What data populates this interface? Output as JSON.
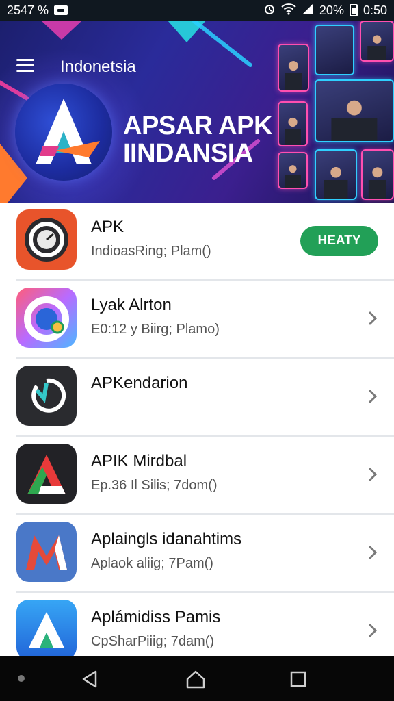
{
  "status_bar": {
    "left_text": "2547 %",
    "left_icons": [
      "message-icon"
    ],
    "right_icons": [
      "alarm-icon",
      "wifi-icon",
      "signal-icon"
    ],
    "battery_text": "20%",
    "time": "0:50"
  },
  "header": {
    "menu_icon": "hamburger-menu-icon",
    "title": "Indonetsia"
  },
  "banner": {
    "logo_letter": "A",
    "headline_line1": "APSAR APK",
    "headline_line2": "IINDANSIA"
  },
  "apps": [
    {
      "name": "APK",
      "subtitle": "IndioasRing; Plam()",
      "icon": "clock-dial-icon",
      "action": "button",
      "action_label": "HEATY"
    },
    {
      "name": "Lyak Alrton",
      "subtitle": "E0:12 y Biirg; Plamo)",
      "icon": "ring-app-icon",
      "action": "chevron"
    },
    {
      "name": "APKendarion",
      "subtitle": "",
      "icon": "sync-circle-icon",
      "action": "chevron"
    },
    {
      "name": "APIK Mirdbal",
      "subtitle": "Ep.36 Il Silis; 7dom()",
      "icon": "a-triangle-icon",
      "action": "chevron"
    },
    {
      "name": "Aplaingls idanahtims",
      "subtitle": "Aplaok aliig; 7Pam()",
      "icon": "m-letter-icon",
      "action": "chevron"
    },
    {
      "name": "Aplámidiss Pamis",
      "subtitle": "CpSharPiiig; 7dam()",
      "icon": "a-blue-icon",
      "action": "chevron"
    }
  ],
  "nav_bar": {
    "buttons": [
      "back-icon",
      "home-icon",
      "recents-icon"
    ]
  },
  "colors": {
    "banner_start": "#1c1f6e",
    "banner_end": "#3b1f8e",
    "accent_green": "#22a057",
    "status_bar": "#101820",
    "nav_bar": "#070707"
  }
}
